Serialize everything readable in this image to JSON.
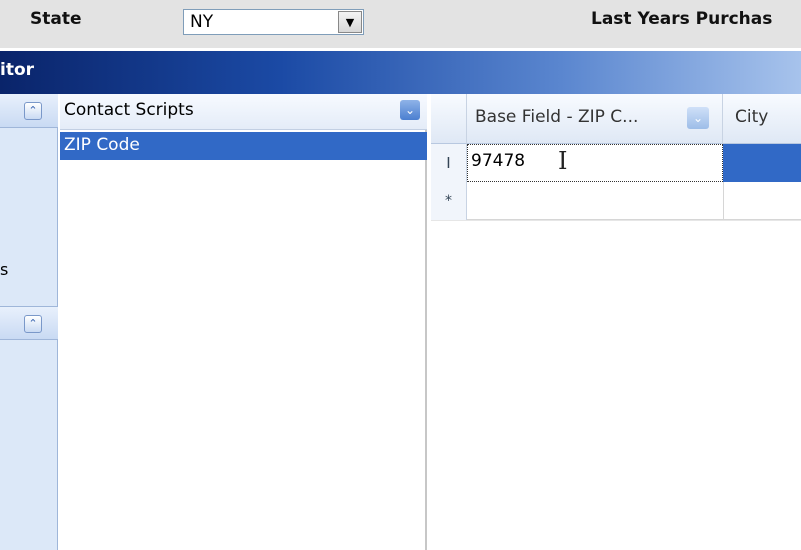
{
  "form": {
    "state_label": "State",
    "state_value": "NY",
    "state_dropdown_glyph": "▼",
    "last_years_label": "Last Years Purchas"
  },
  "window": {
    "title_fragment": "itor",
    "gradient_colors": [
      "#0a246a",
      "#1b4aa5",
      "#5a86cf",
      "#a7c3ec"
    ]
  },
  "side_strip": {
    "collapse_glyph": "⌃",
    "truncated_label": "s"
  },
  "list_panel": {
    "header": "Contact Scripts",
    "header_dropdown_glyph": "⌄",
    "items": [
      "ZIP Code"
    ],
    "selection_color": "#3169c6"
  },
  "grid": {
    "columns": [
      "Base Field - ZIP C...",
      "City"
    ],
    "column_dropdown_glyph": "⌄",
    "rows": [
      {
        "indicator": "I",
        "values": [
          "97478",
          ""
        ]
      }
    ],
    "new_row_indicator": "*",
    "text_cursor_glyph": "I"
  }
}
